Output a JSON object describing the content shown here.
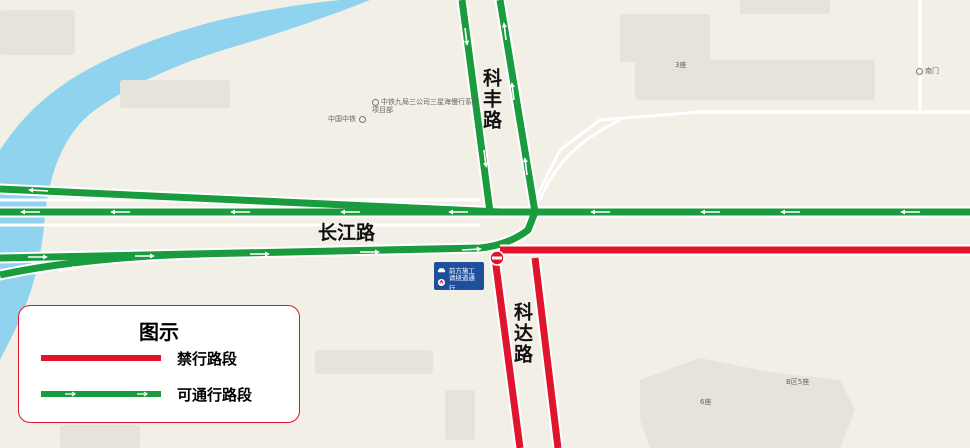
{
  "roads": {
    "changjiang": "长江路",
    "kefeng": "科丰路",
    "keda": "科达路"
  },
  "pois": {
    "company": "中铁九局三公司三星海慢行系统项目部",
    "crcc": "中国中铁",
    "building3": "3座",
    "south_gate": "南门",
    "building6": "6座",
    "zone_b5": "B区5座"
  },
  "notice": {
    "line1": "前方施工",
    "line2": "请绕道通行"
  },
  "legend": {
    "title": "图示",
    "closed_label": "禁行路段",
    "open_label": "可通行路段"
  },
  "colors": {
    "closed": "#e0142a",
    "open": "#1a9c3e",
    "water": "#8fd3ef",
    "land": "#f2efe6",
    "block": "#e6e3da",
    "notice_bg": "#1f4f9c"
  }
}
